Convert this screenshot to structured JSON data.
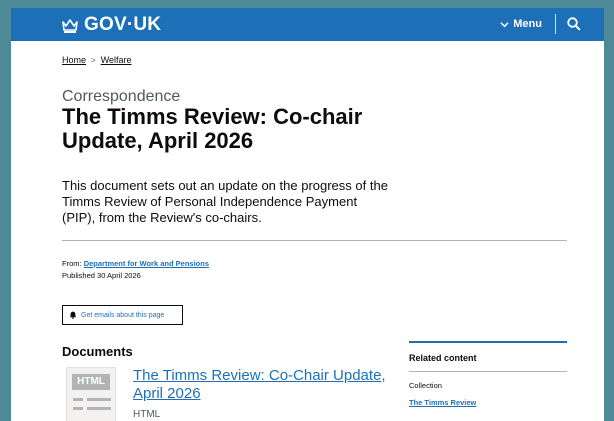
{
  "header": {
    "logo_text": "GOV·UK",
    "menu_label": "Menu",
    "brand_color": "#1d70b8"
  },
  "breadcrumb": {
    "items": [
      "Home",
      "Welfare"
    ],
    "separator": ">"
  },
  "document": {
    "caption": "Correspondence",
    "title": "The Timms Review: Co-chair Update, April 2026",
    "lede": "This document sets out an update on the progress of the Timms Review of Personal Independence Payment (PIP), from the Review's co-chairs."
  },
  "meta": {
    "from_label": "From:",
    "from_org": "Department for Work and Pensions",
    "published": "Published 30 April 2026"
  },
  "email_button": {
    "label": "Get emails about this page"
  },
  "documents": {
    "heading": "Documents",
    "items": [
      {
        "thumb_label": "HTML",
        "title": "The Timms Review: Co-Chair Update, April 2026",
        "type": "HTML"
      }
    ]
  },
  "related": {
    "heading": "Related content",
    "collection_label": "Collection",
    "link": "The Timms Review"
  }
}
